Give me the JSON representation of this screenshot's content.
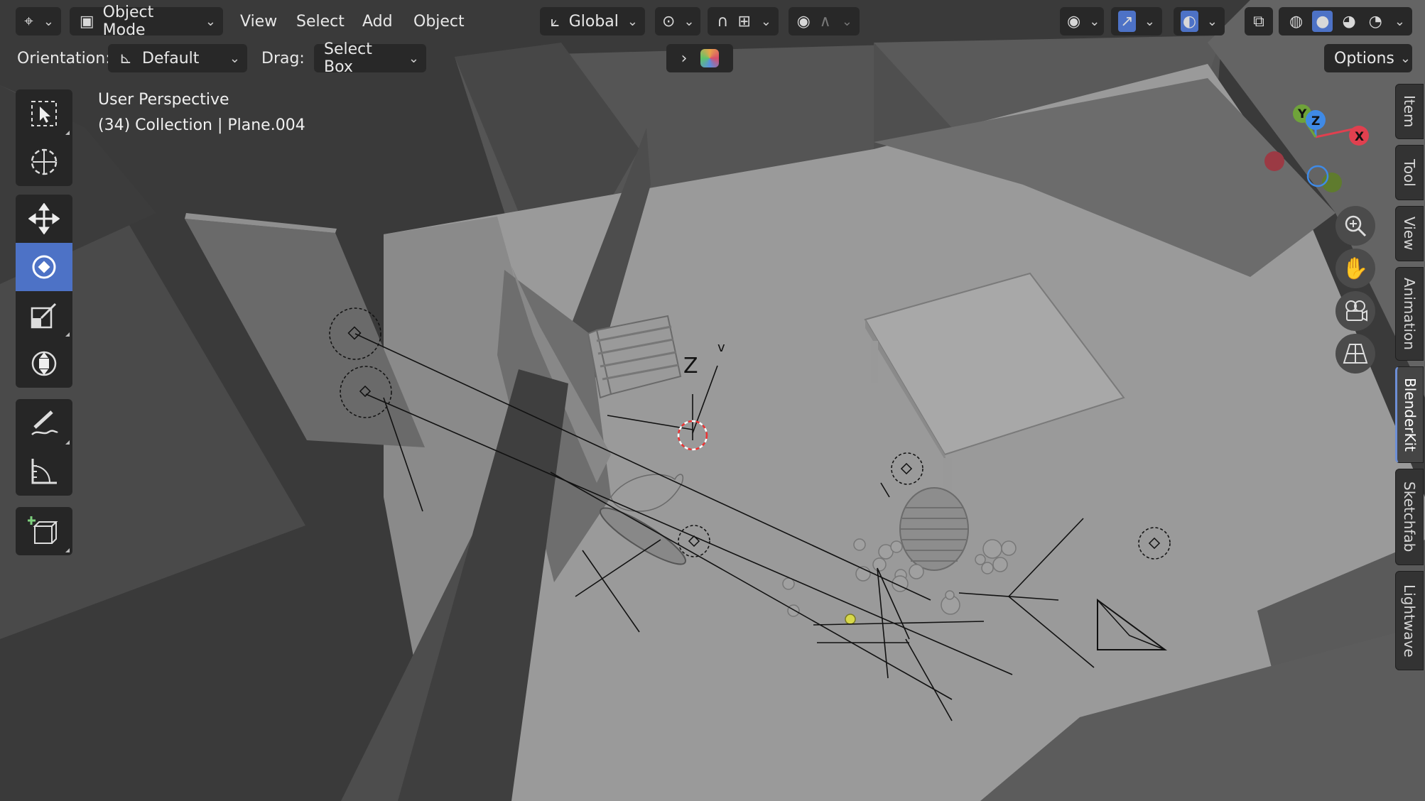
{
  "header": {
    "editor_type_icon": "transform-orientation-icon",
    "mode": "Object Mode",
    "menus": [
      "View",
      "Select",
      "Add",
      "Object"
    ],
    "transform_orientation": "Global",
    "icons": {
      "pivot": "pivot-point-icon",
      "snap": "magnet-icon",
      "snap_target": "snap-increment-icon",
      "proportional": "proportional-edit-icon",
      "falloff": "falloff-curve-icon",
      "visibility": "eye-icon",
      "gizmo": "gizmo-icon",
      "overlay": "overlay-icon",
      "xray": "xray-icon",
      "shading": [
        "wireframe-shading-icon",
        "solid-shading-icon",
        "material-shading-icon",
        "rendered-shading-icon"
      ]
    }
  },
  "tool_header": {
    "orientation_label": "Orientation:",
    "orientation_value": "Default",
    "drag_label": "Drag:",
    "drag_value": "Select Box",
    "options_label": "Options",
    "addon_icon": "blenderkit-cube-icon",
    "expand_icon": "chevron-right-icon"
  },
  "viewport_overlay": {
    "perspective_text": "User Perspective",
    "collection_text": "(34) Collection | Plane.004"
  },
  "toolbar": {
    "tools": [
      {
        "name": "select-box-tool",
        "icon": "select-box-icon",
        "active": false
      },
      {
        "name": "cursor-tool",
        "icon": "cursor-icon",
        "active": false
      },
      {
        "name": "move-tool",
        "icon": "move-icon",
        "active": false
      },
      {
        "name": "rotate-tool",
        "icon": "rotate-icon",
        "active": true
      },
      {
        "name": "scale-tool",
        "icon": "scale-icon",
        "active": false
      },
      {
        "name": "transform-tool",
        "icon": "transform-icon",
        "active": false
      },
      {
        "name": "annotate-tool",
        "icon": "annotate-icon",
        "active": false
      },
      {
        "name": "measure-tool",
        "icon": "measure-icon",
        "active": false
      },
      {
        "name": "add-cube-tool",
        "icon": "add-cube-icon",
        "active": false
      }
    ]
  },
  "gizmo": {
    "axes": [
      "X",
      "Y",
      "Z"
    ],
    "colors": {
      "x": "#e0404f",
      "y": "#6fa33a",
      "z": "#3f8ae6"
    }
  },
  "nav_buttons": [
    "zoom-icon",
    "hand-pan-icon",
    "camera-view-icon",
    "perspective-grid-icon"
  ],
  "sidebar_tabs": [
    "Item",
    "Tool",
    "View",
    "Animation",
    "BlenderKit",
    "Sketchfab",
    "Lightwave"
  ],
  "active_tab": "BlenderKit",
  "colors": {
    "active_tool": "#4d72c6",
    "header_bg": "#303030"
  }
}
